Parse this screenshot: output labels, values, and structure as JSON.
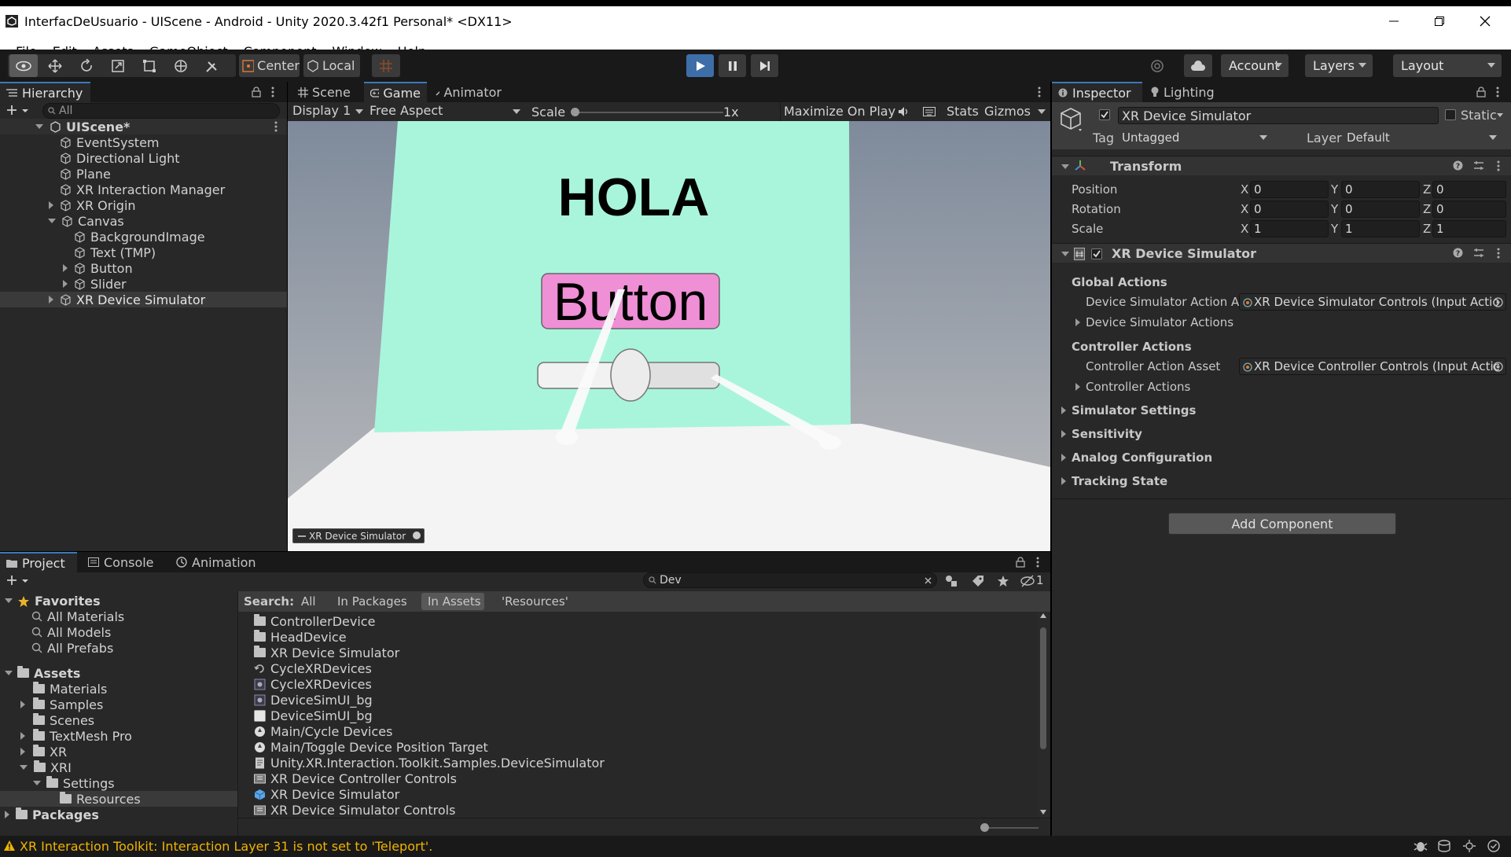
{
  "window": {
    "title": "InterfacDeUsuario - UIScene - Android - Unity 2020.3.42f1 Personal* <DX11>"
  },
  "menu": [
    "File",
    "Edit",
    "Assets",
    "GameObject",
    "Component",
    "Window",
    "Help"
  ],
  "toolbar": {
    "pivot": "Center",
    "space": "Local",
    "account": "Account",
    "layers": "Layers",
    "layout": "Layout"
  },
  "hierarchy": {
    "tab": "Hierarchy",
    "search_placeholder": "All",
    "scene": "UIScene*",
    "items": [
      "EventSystem",
      "Directional Light",
      "Plane",
      "XR Interaction Manager",
      "XR Origin",
      "Canvas",
      "BackgroundImage",
      "Text (TMP)",
      "Button",
      "Slider",
      "XR Device Simulator"
    ]
  },
  "game_view": {
    "tabs": [
      "Scene",
      "Game",
      "Animator"
    ],
    "display": "Display 1",
    "aspect": "Free Aspect",
    "scale_label": "Scale",
    "scale_value": "1x",
    "maximize": "Maximize On Play",
    "stats": "Stats",
    "gizmos": "Gizmos",
    "canvas_text": "HOLA",
    "canvas_button": "Button",
    "simulator_badge": "XR Device Simulator",
    "colors": {
      "panel": "#a8f5dc",
      "button": "#ef8fd6",
      "floor": "#f4f4f4"
    }
  },
  "inspector": {
    "tabs": [
      "Inspector",
      "Lighting"
    ],
    "object_name": "XR Device Simulator",
    "static_label": "Static",
    "tag_label": "Tag",
    "tag_value": "Untagged",
    "layer_label": "Layer",
    "layer_value": "Default",
    "transform": {
      "title": "Transform",
      "rows": [
        {
          "label": "Position",
          "x": "0",
          "y": "0",
          "z": "0"
        },
        {
          "label": "Rotation",
          "x": "0",
          "y": "0",
          "z": "0"
        },
        {
          "label": "Scale",
          "x": "1",
          "y": "1",
          "z": "1"
        }
      ]
    },
    "component": {
      "title": "XR Device Simulator",
      "global_actions": "Global Actions",
      "device_sim_action_asset_label": "Device Simulator Action As",
      "device_sim_action_asset_value": "XR Device Simulator Controls (Input Actio",
      "device_sim_actions": "Device Simulator Actions",
      "controller_actions": "Controller Actions",
      "controller_action_asset_label": "Controller Action Asset",
      "controller_action_asset_value": "XR Device Controller Controls (Input Actic",
      "controller_actions_fold": "Controller Actions",
      "sections": [
        "Simulator Settings",
        "Sensitivity",
        "Analog Configuration",
        "Tracking State"
      ]
    },
    "add_component": "Add Component"
  },
  "project": {
    "tabs": [
      "Project",
      "Console",
      "Animation"
    ],
    "search_value": "Dev",
    "hidden_count": "1",
    "search_label": "Search:",
    "search_scopes": [
      "All",
      "In Packages",
      "In Assets",
      "'Resources'"
    ],
    "tree": {
      "favorites": "Favorites",
      "fav_items": [
        "All Materials",
        "All Models",
        "All Prefabs"
      ],
      "assets": "Assets",
      "asset_items": [
        "Materials",
        "Samples",
        "Scenes",
        "TextMesh Pro",
        "XR",
        "XRI",
        "Settings",
        "Resources"
      ],
      "packages": "Packages"
    },
    "results": [
      "ControllerDevice",
      "HeadDevice",
      "XR Device Simulator",
      "CycleXRDevices",
      "CycleXRDevices",
      "DeviceSimUI_bg",
      "DeviceSimUI_bg",
      "Main/Cycle Devices",
      "Main/Toggle Device Position Target",
      "Unity.XR.Interaction.Toolkit.Samples.DeviceSimulator",
      "XR Device Controller Controls",
      "XR Device Simulator",
      "XR Device Simulator Controls"
    ]
  },
  "status": {
    "message": "XR Interaction Toolkit: Interaction Layer 31 is not set to 'Teleport'.",
    "color": "#f0b400"
  }
}
